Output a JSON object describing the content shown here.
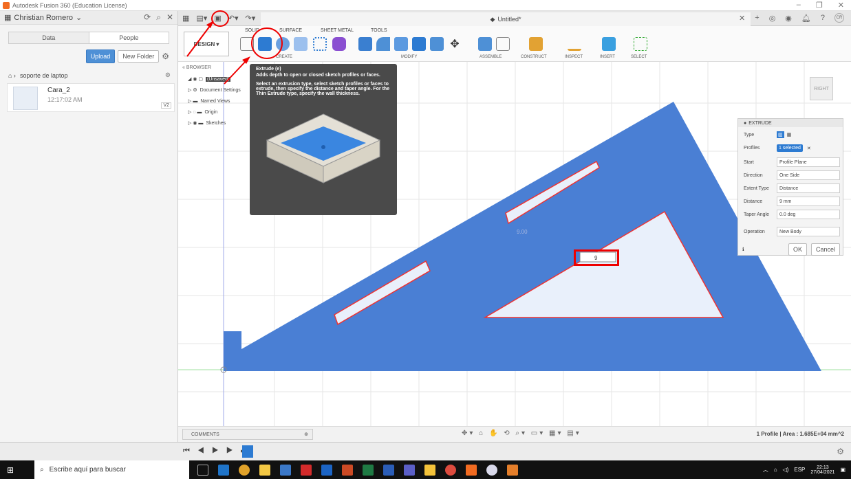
{
  "window": {
    "title": "Autodesk Fusion 360 (Education License)"
  },
  "data_panel": {
    "user": "Christian Romero",
    "tabs": [
      "Data",
      "People"
    ],
    "upload_label": "Upload",
    "new_folder_label": "New Folder",
    "breadcrumb": "soporte de laptop",
    "file": {
      "name": "Cara_2",
      "time": "12:17:02 AM",
      "version": "V2"
    }
  },
  "document": {
    "title": "Untitled*"
  },
  "ribbon": {
    "design_label": "DESIGN",
    "tabs": [
      "SOLID",
      "SURFACE",
      "SHEET METAL",
      "TOOLS"
    ],
    "groups": [
      "CREATE",
      "MODIFY",
      "ASSEMBLE",
      "CONSTRUCT",
      "INSPECT",
      "INSERT",
      "SELECT"
    ]
  },
  "browser": {
    "header": "BROWSER",
    "items": [
      "(Unsaved)",
      "Document Settings",
      "Named Views",
      "Origin",
      "Sketches"
    ]
  },
  "tooltip": {
    "title": "Extrude (e)",
    "desc1": "Adds depth to open or closed sketch profiles or faces.",
    "desc2": "Select an extrusion type, select sketch profiles or faces to extrude, then specify the distance and taper angle. For the Thin Extrude type, specify the wall thickness."
  },
  "viewcube": {
    "face": "RIGHT"
  },
  "canvas": {
    "dimension_label": "9.00",
    "input_value": "9"
  },
  "extrude_panel": {
    "header": "EXTRUDE",
    "rows": [
      {
        "label": "Type",
        "value": ""
      },
      {
        "label": "Profiles",
        "value": "1 selected"
      },
      {
        "label": "Start",
        "value": "Profile Plane"
      },
      {
        "label": "Direction",
        "value": "One Side"
      },
      {
        "label": "Extent Type",
        "value": "Distance"
      },
      {
        "label": "Distance",
        "value": "9 mm"
      },
      {
        "label": "Taper Angle",
        "value": "0.0 deg"
      },
      {
        "label": "Operation",
        "value": "New Body"
      }
    ],
    "ok_label": "OK",
    "cancel_label": "Cancel"
  },
  "bottom_bar": {
    "comments_label": "COMMENTS",
    "area_text": "1 Profile | Area : 1.685E+04 mm^2"
  },
  "taskbar": {
    "search_placeholder": "Escribe aquí para buscar",
    "lang": "ESP",
    "time": "22:13",
    "date": "27/04/2021"
  },
  "colors": {
    "body": "#4a7fd4",
    "accent": "#2d7bd2",
    "highlight": "#ee0000"
  }
}
